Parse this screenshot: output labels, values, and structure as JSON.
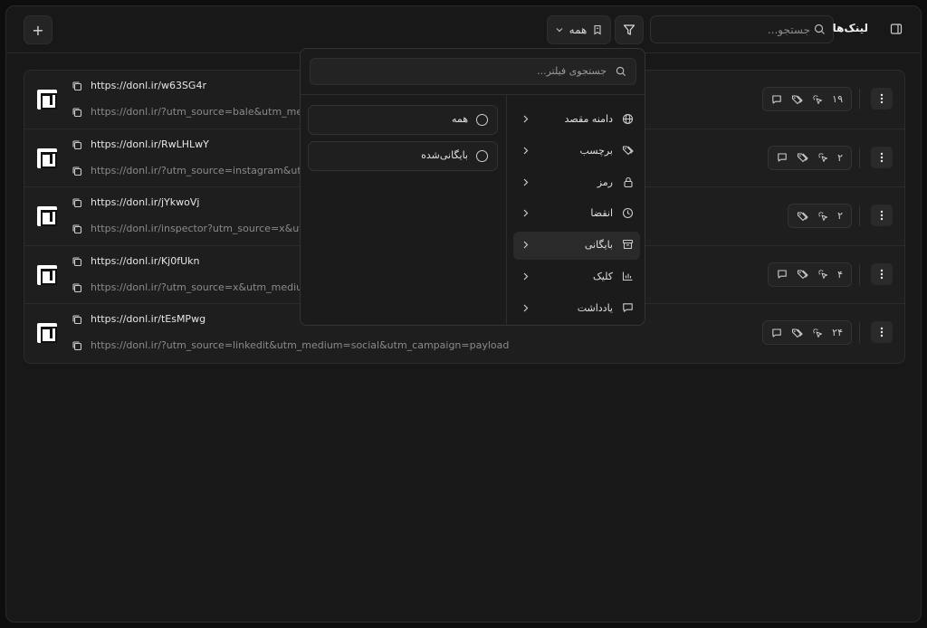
{
  "header": {
    "title": "لینک‌ها",
    "search_placeholder": "جستجو...",
    "view_filter_label": "همه",
    "add_label": "+"
  },
  "links": [
    {
      "short": "https://donl.ir/w63SG4r",
      "long": "https://donl.ir/?utm_source=bale&utm_medium",
      "clicks": "۱۹",
      "has_comment": true
    },
    {
      "short": "https://donl.ir/RwLHLwY",
      "long": "https://donl.ir/?utm_source=instagram&utm_me",
      "clicks": "۲",
      "has_comment": true
    },
    {
      "short": "https://donl.ir/jYkwoVj",
      "long": "https://donl.ir/inspector?utm_source=x&utm_m",
      "clicks": "۲",
      "has_comment": false
    },
    {
      "short": "https://donl.ir/Kj0fUkn",
      "long": "https://donl.ir/?utm_source=x&utm_medium=so",
      "clicks": "۴",
      "has_comment": true
    },
    {
      "short": "https://donl.ir/tEsMPwg",
      "long": "https://donl.ir/?utm_source=linkedit&utm_medium=social&utm_campaign=payload",
      "clicks": "۲۴",
      "has_comment": true
    }
  ],
  "filter_menu": {
    "search_placeholder": "جستجوی فیلتر...",
    "categories": [
      {
        "label": "دامنه مقصد",
        "icon": "globe-icon"
      },
      {
        "label": "برچسب",
        "icon": "tags-icon"
      },
      {
        "label": "رمز",
        "icon": "lock-icon"
      },
      {
        "label": "انقضا",
        "icon": "clock-icon"
      },
      {
        "label": "بایگانی",
        "icon": "archive-icon",
        "active": true
      },
      {
        "label": "کلیک",
        "icon": "bar-chart-icon"
      },
      {
        "label": "یادداشت",
        "icon": "note-icon"
      }
    ],
    "options": [
      {
        "label": "همه"
      },
      {
        "label": "بایگانی‌شده"
      }
    ]
  }
}
